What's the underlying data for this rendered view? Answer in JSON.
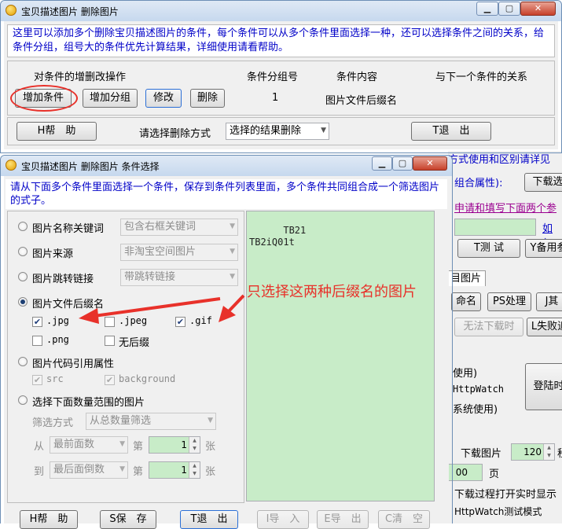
{
  "main_window": {
    "title": "宝贝描述图片 删除图片",
    "info_text": "这里可以添加多个删除宝贝描述图片的条件，每个条件可以从多个条件里面选择一种，还可以选择条件之间的关系，给条件分组，组号大的条件优先计算结果，详细使用请看帮助。",
    "headers": {
      "ops": "对条件的增删改操作",
      "group": "条件分组号",
      "content": "条件内容",
      "relation": "与下一个条件的关系"
    },
    "buttons": {
      "add_condition": "增加条件",
      "add_group": "增加分组",
      "modify": "修改",
      "delete": "删除"
    },
    "row": {
      "group": "1",
      "content": "图片文件后缀名",
      "relation": ""
    },
    "help": "H帮　助",
    "method_label": "请选择删除方式",
    "method_value": "选择的结果删除",
    "exit": "T退　出"
  },
  "background_window": {
    "lines": [
      "方式使用和区别请详见",
      "组合属性):",
      "申请和填写下面两个参",
      "如何",
      "T测 试",
      "Y备用参",
      "目图片",
      "命名",
      "PS处理",
      "J其",
      "无法下载时",
      "L失败追",
      "使用)",
      "HttpWatch",
      "系统使用)",
      "下载图片",
      "页",
      "下载过程打开实时显示",
      "HttpWatch测试模式"
    ],
    "download_btn": "下载选",
    "login_btn": "登陆时",
    "download_count": "120",
    "partial_char": "秒",
    "page_num": "00"
  },
  "dialog": {
    "title": "宝贝描述图片 删除图片 条件选择",
    "info_text": "请从下面多个条件里面选择一个条件，保存到条件列表里面，多个条件共同组合成一个筛选图片的式子。",
    "options": [
      {
        "label": "图片名称关键词",
        "combo": "包含右框关键词",
        "checked": false
      },
      {
        "label": "图片来源",
        "combo": "非淘宝空间图片",
        "checked": false
      },
      {
        "label": "图片跳转链接",
        "combo": "带跳转链接",
        "checked": false
      },
      {
        "label": "图片文件后缀名",
        "checked": true
      },
      {
        "label": "图片代码引用属性",
        "checked": false
      },
      {
        "label": "选择下面数量范围的图片",
        "checked": false
      }
    ],
    "suffixes": [
      {
        "label": ".jpg",
        "checked": true
      },
      {
        "label": ".jpeg",
        "checked": false
      },
      {
        "label": ".gif",
        "checked": true
      },
      {
        "label": ".png",
        "checked": false
      },
      {
        "label": "无后缀",
        "checked": false
      }
    ],
    "attrs": [
      {
        "label": "src",
        "checked": true
      },
      {
        "label": "background",
        "checked": true
      }
    ],
    "range": {
      "filter_label": "筛选方式",
      "filter_value": "从总数量筛选",
      "from_label": "从",
      "from_value": "最前面数",
      "from_nth": "第",
      "from_num": "1",
      "from_unit": "张",
      "to_label": "到",
      "to_value": "最后面倒数",
      "to_nth": "第",
      "to_num": "1",
      "to_unit": "张"
    },
    "textarea": "TB21\nTB2iQ01t",
    "buttons": {
      "help": "H帮　助",
      "save": "S保　存",
      "exit": "T退　出",
      "import": "I导　入",
      "export": "E导　出",
      "clear": "C清　空"
    }
  },
  "annotation": {
    "text": "只选择这两种后缀名的图片",
    "color": "#e8312a"
  }
}
